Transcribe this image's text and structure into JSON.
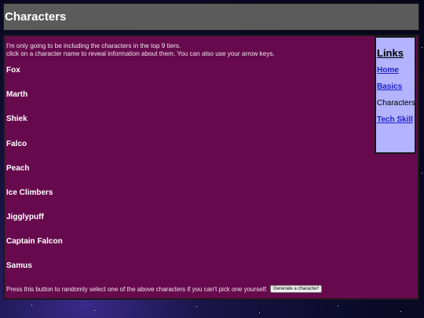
{
  "header": {
    "title": "Characters"
  },
  "intro": {
    "line1": "I'm only going to be including the characters in the top 9 tiers.",
    "line2": "click on a character name to reveal information about them. You can also use your arrow keys."
  },
  "characters": [
    "Fox",
    "Marth",
    "Shiek",
    "Falco",
    "Peach",
    "Ice Climbers",
    "Jigglypuff",
    "Captain Falcon",
    "Samus"
  ],
  "random": {
    "text": "Press this button to randomly select one of the above characters if you can't pick one yourself.",
    "button_label": "Generate a character!"
  },
  "links": {
    "title": "Links",
    "items": [
      {
        "label": "Home"
      },
      {
        "label": "Basics"
      },
      {
        "label": "Characters"
      },
      {
        "label": "Tech Skill"
      }
    ]
  },
  "colors": {
    "header_bg": "#5b5b5b",
    "main_bg": "#660a4d",
    "links_bg": "#b3b3ff",
    "link_color": "#2222cc"
  }
}
